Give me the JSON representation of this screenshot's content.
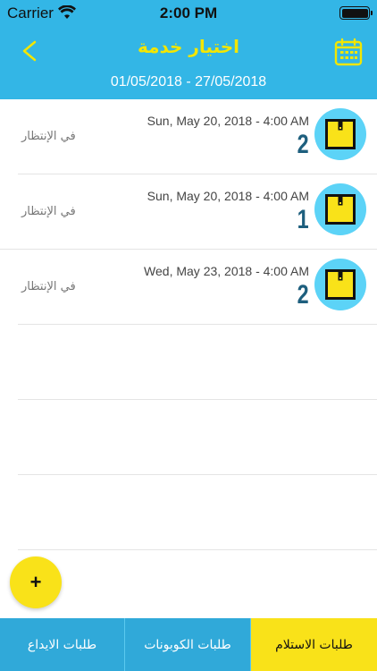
{
  "status_bar": {
    "carrier": "Carrier",
    "time": "2:00 PM"
  },
  "header": {
    "title": "اختيار خدمة",
    "date_range": "01/05/2018 - 27/05/2018",
    "back_icon": "chevron-left-icon",
    "calendar_icon": "calendar-icon"
  },
  "orders": [
    {
      "date": "Sun, May 20, 2018 - 4:00 AM",
      "quantity": "2",
      "status": "في الإنتظار"
    },
    {
      "date": "Sun, May 20, 2018 - 4:00 AM",
      "quantity": "1",
      "status": "في الإنتظار"
    },
    {
      "date": "Wed, May 23, 2018 - 4:00 AM",
      "quantity": "2",
      "status": "في الإنتظار"
    }
  ],
  "fab": {
    "label": "+"
  },
  "tabs": [
    {
      "label": "طلبات الايداع"
    },
    {
      "label": "طلبات الكوبونات"
    },
    {
      "label": "طلبات الاستلام"
    }
  ],
  "colors": {
    "header_bg": "#33b6e6",
    "accent_yellow": "#f9e219",
    "title_yellow": "#f3e600",
    "avatar_bg": "#5cd3f7",
    "quantity_text": "#1e5f7e",
    "tab_blue": "#30a9d9"
  }
}
